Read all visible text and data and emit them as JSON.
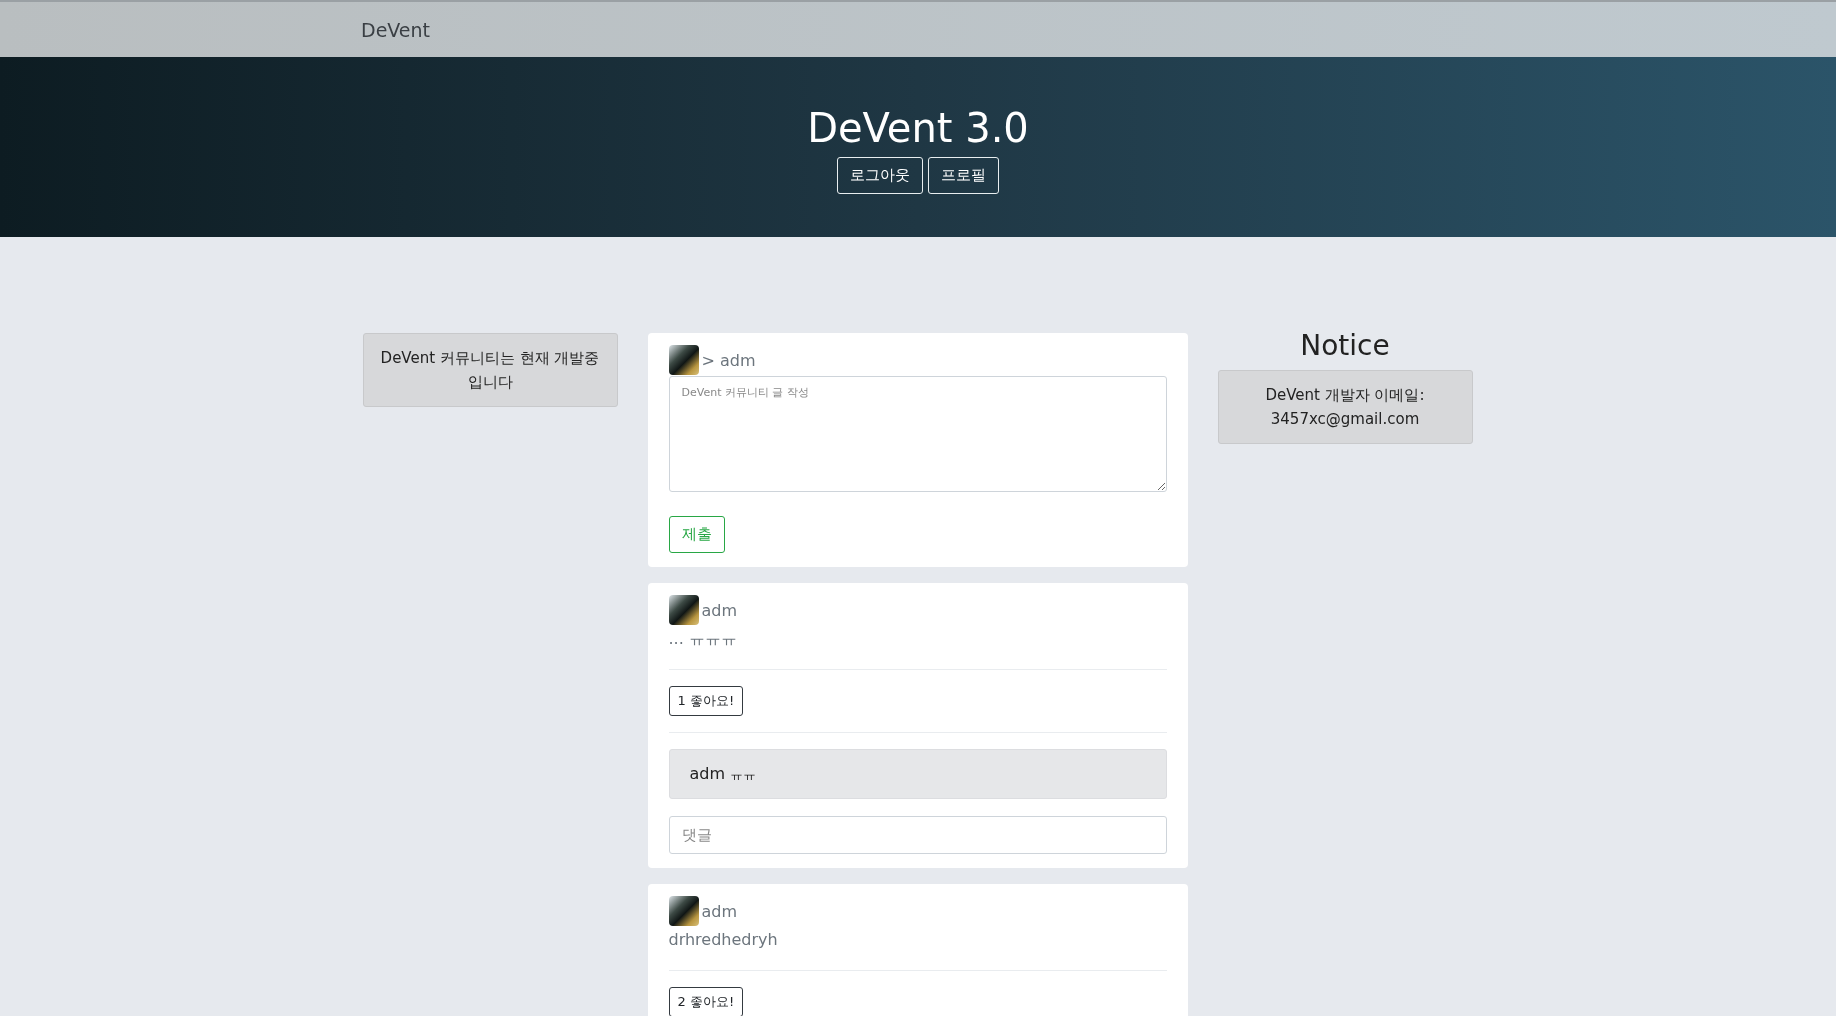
{
  "navbar": {
    "brand": "DeVent"
  },
  "hero": {
    "title": "DeVent 3.0",
    "buttons": [
      "로그아웃",
      "프로필"
    ]
  },
  "left_notice": {
    "text": "DeVent 커뮤니티는 현재 개발중 입니다"
  },
  "composer": {
    "author": "> adm",
    "placeholder": "DeVent 커뮤니티 글 작성",
    "submit": "제출"
  },
  "posts": [
    {
      "author": "adm",
      "body": "... ㅠㅠㅠ",
      "likes": "1 좋아요!",
      "comments": [
        {
          "author": "adm",
          "text": "ㅠㅠ"
        }
      ],
      "comment_placeholder": "댓글"
    },
    {
      "author": "adm",
      "body": "drhredhedryh",
      "likes": "2 좋아요!"
    }
  ],
  "notice": {
    "title": "Notice",
    "lines": [
      "DeVent 개발자 이메일:",
      "3457xc@gmail.com"
    ]
  }
}
